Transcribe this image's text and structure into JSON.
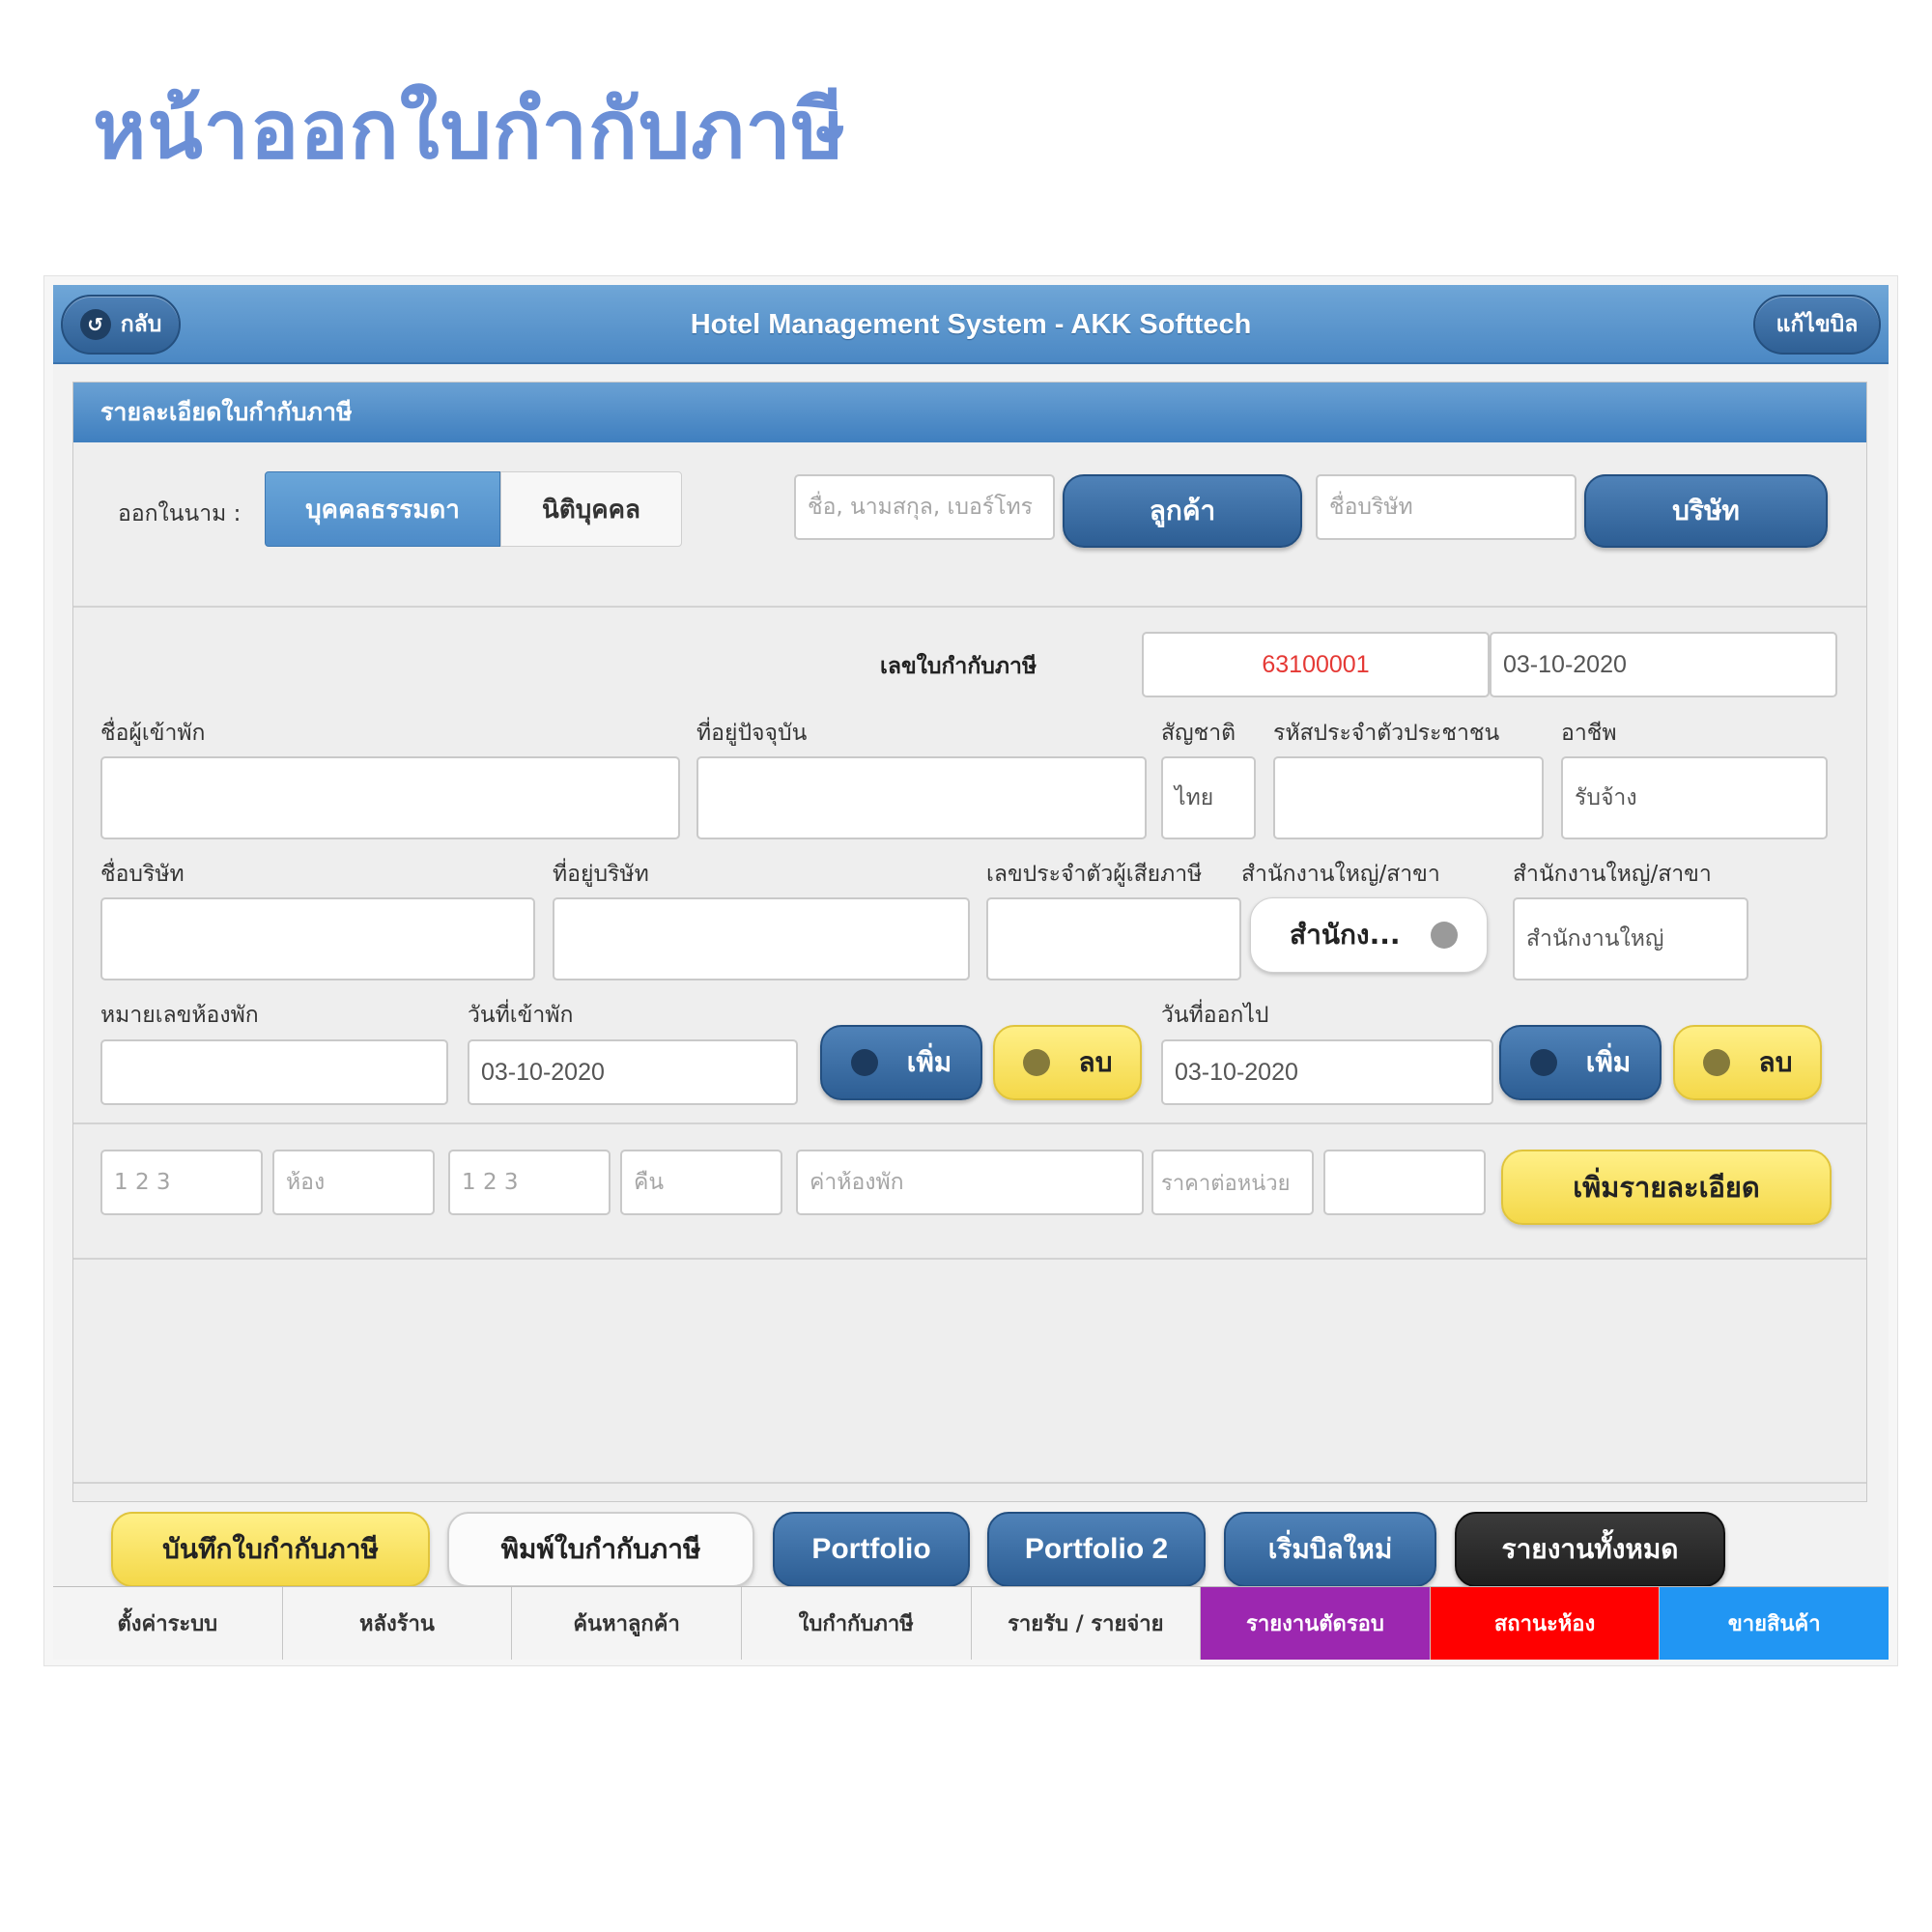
{
  "page_title": "หน้าออกใบกำกับภาษี",
  "header": {
    "title": "Hotel Management System - AKK Softtech",
    "back_label": "กลับ",
    "edit_label": "แก้ไขบิล"
  },
  "panel": {
    "title": "รายละเอียดใบกำกับภาษี",
    "issue_in_name_label": "ออกในนาม :",
    "segment": {
      "individual": "บุคคลธรรมดา",
      "juristic": "นิติบุคคล"
    },
    "customer_search_placeholder": "ชื่อ, นามสกุล, เบอร์โทร",
    "customer_button": "ลูกค้า",
    "company_search_placeholder": "ชื่อบริษัท",
    "company_button": "บริษัท"
  },
  "invoice": {
    "number_label": "เลขใบกำกับภาษี",
    "number": "63100001",
    "date": "03-10-2020"
  },
  "guest": {
    "name_label": "ชื่อผู้เข้าพัก",
    "name": "",
    "address_label": "ที่อยู่ปัจจุบัน",
    "address": "",
    "nationality_label": "สัญชาติ",
    "nationality": "ไทย",
    "id_card_label": "รหัสประจำตัวประชาชน",
    "id_card": "",
    "occupation_label": "อาชีพ",
    "occupation": "รับจ้าง"
  },
  "company": {
    "name_label": "ชื่อบริษัท",
    "name": "",
    "address_label": "ที่อยู่บริษัท",
    "address": "",
    "tax_id_label": "เลขประจำตัวผู้เสียภาษี",
    "tax_id": "",
    "branch_toggle_label": "สำนักงานใหญ่/สาขา",
    "branch_toggle_value": "สำนักง...",
    "branch_label": "สำนักงานใหญ่/สาขา",
    "branch": "สำนักงานใหญ่"
  },
  "stay": {
    "room_no_label": "หมายเลขห้องพัก",
    "room_no": "",
    "checkin_label": "วันที่เข้าพัก",
    "checkin": "03-10-2020",
    "checkout_label": "วันที่ออกไป",
    "checkout": "03-10-2020",
    "add_label": "เพิ่ม",
    "delete_label": "ลบ"
  },
  "detail_line": {
    "qty_rooms_placeholder": "1 2 3",
    "rooms_unit": "ห้อง",
    "qty_nights_placeholder": "1 2 3",
    "nights_unit": "คืน",
    "description_placeholder": "ค่าห้องพัก",
    "unit_price_placeholder": "ราคาต่อหน่วย",
    "amount": "",
    "add_detail_button": "เพิ่มรายละเอียด"
  },
  "actions": {
    "save": "บันทึกใบกำกับภาษี",
    "print": "พิมพ์ใบกำกับภาษี",
    "portfolio": "Portfolio",
    "portfolio2": "Portfolio 2",
    "new_bill": "เริ่มบิลใหม่",
    "all_reports": "รายงานทั้งหมด"
  },
  "nav": [
    "ตั้งค่าระบบ",
    "หลังร้าน",
    "ค้นหาลูกค้า",
    "ใบกำกับภาษี",
    "รายรับ / รายจ่าย",
    "รายงานตัดรอบ",
    "สถานะห้อง",
    "ขายสินค้า"
  ],
  "colors": {
    "title": "#6b8fd6",
    "header": "#4b88c4",
    "nav_purple": "#9c27b0",
    "nav_red": "#ff0000",
    "nav_blue": "#2196f3",
    "invoice_number": "#e53935"
  }
}
